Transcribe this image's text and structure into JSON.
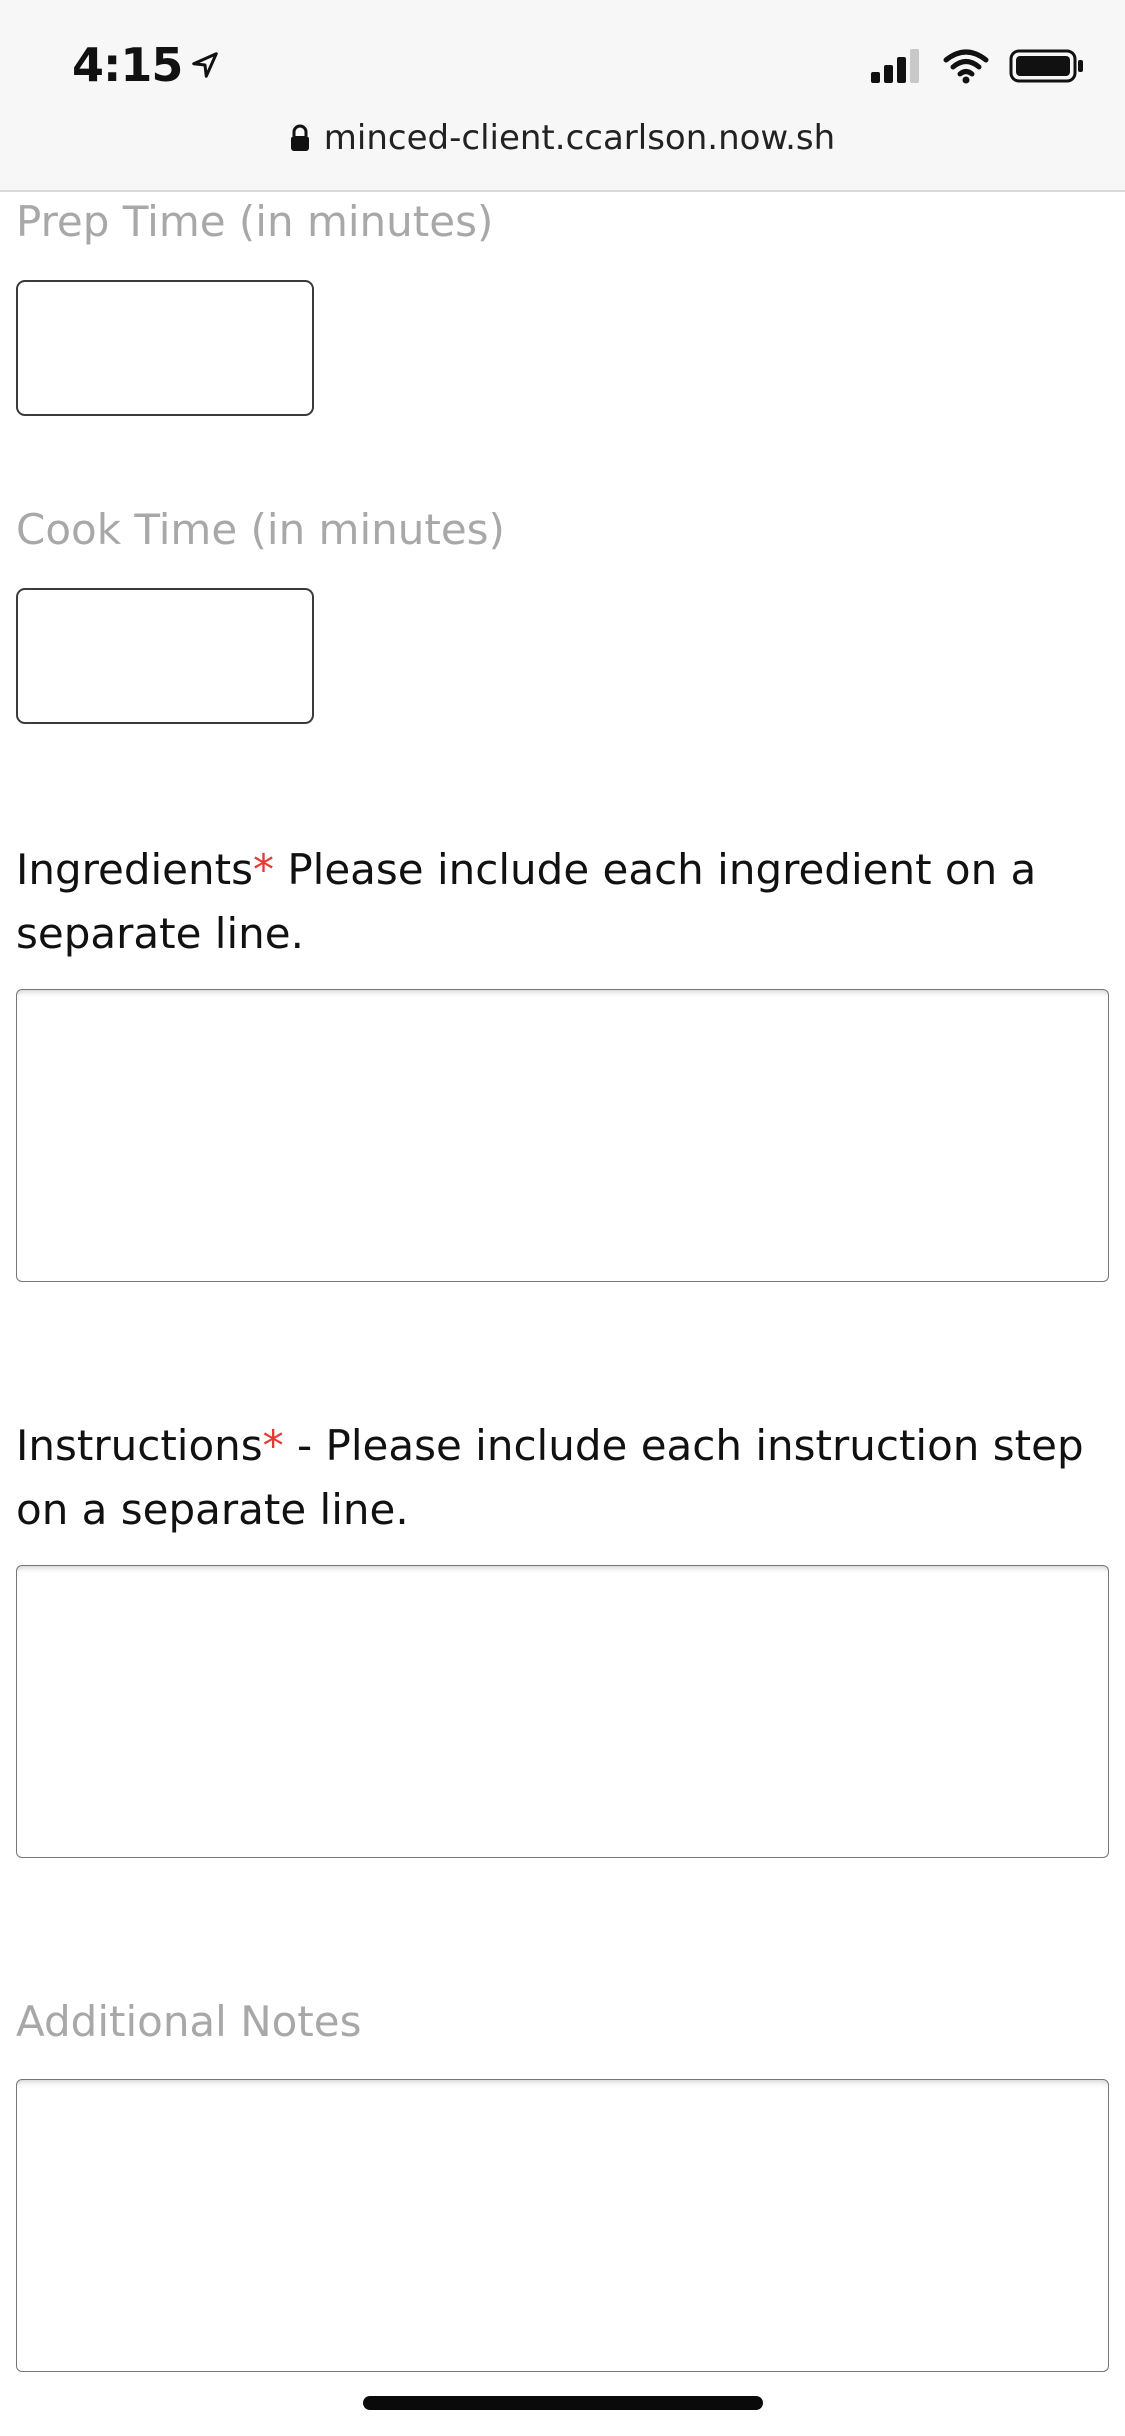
{
  "status_bar": {
    "time": "4:15",
    "location_icon": "location-arrow-icon",
    "signal_icon": "cellular-signal-icon",
    "wifi_icon": "wifi-icon",
    "battery_icon": "battery-icon"
  },
  "browser": {
    "url": "minced-client.ccarlson.now.sh",
    "lock_icon": "lock-icon"
  },
  "form": {
    "prep_time": {
      "label": "Prep Time (in minutes)",
      "value": ""
    },
    "cook_time": {
      "label": "Cook Time (in minutes)",
      "value": ""
    },
    "ingredients": {
      "label": "Ingredients",
      "required_mark": "*",
      "help": " Please include each ingredient on a separate line.",
      "value": ""
    },
    "instructions": {
      "label": "Instructions",
      "required_mark": "*",
      "help": " - Please include each instruction step on a separate line.",
      "value": ""
    },
    "additional_notes": {
      "label": "Additional Notes",
      "value": ""
    }
  },
  "colors": {
    "required_asterisk": "#e53935",
    "optional_label": "#a8a8a8",
    "status_bar_bg": "#f7f7f7"
  }
}
